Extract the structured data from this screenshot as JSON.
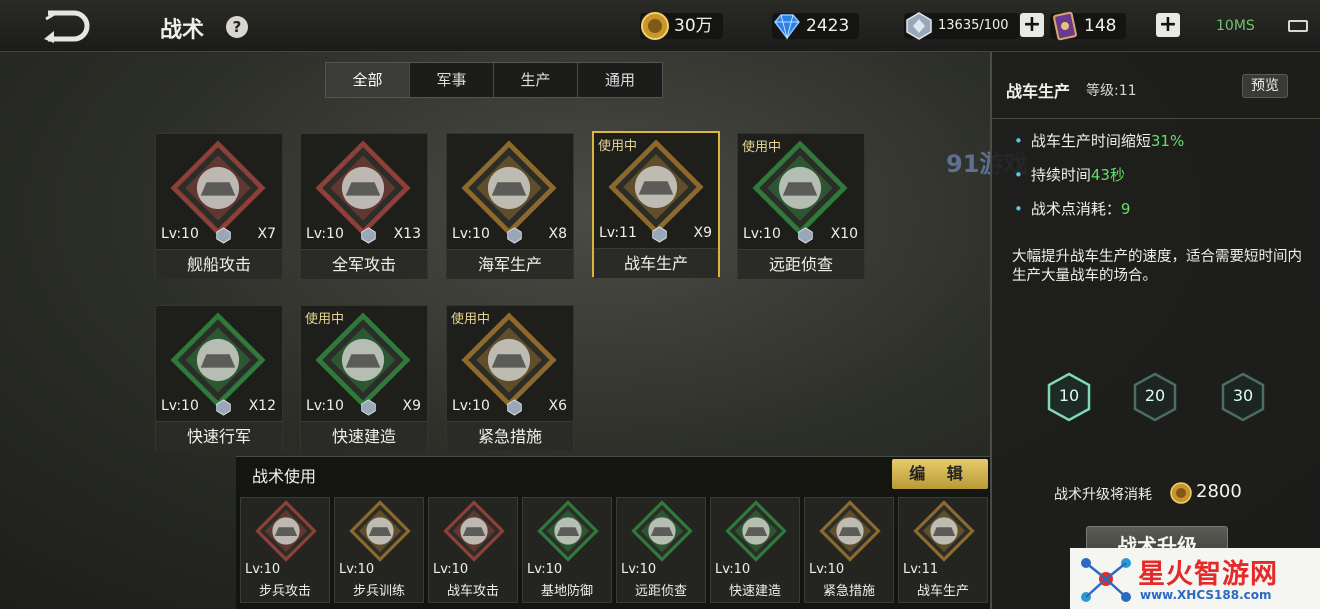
{
  "header": {
    "title": "战术",
    "help_label": "?",
    "gold": "30万",
    "diamond": "2423",
    "crystal": "13635/100",
    "card": "148",
    "ping": "10MS"
  },
  "tabs": [
    "全部",
    "军事",
    "生产",
    "通用"
  ],
  "skills": [
    {
      "name": "舰船攻击",
      "lv": "Lv:10",
      "count": "X7",
      "inuse": "",
      "theme": "#8e4038"
    },
    {
      "name": "全军攻击",
      "lv": "Lv:10",
      "count": "X13",
      "inuse": "",
      "theme": "#8e4038"
    },
    {
      "name": "海军生产",
      "lv": "Lv:10",
      "count": "X8",
      "inuse": "",
      "theme": "#8d6a2c"
    },
    {
      "name": "战车生产",
      "lv": "Lv:11",
      "count": "X9",
      "inuse": "使用中",
      "theme": "#8d6a2c"
    },
    {
      "name": "远距侦查",
      "lv": "Lv:10",
      "count": "X10",
      "inuse": "使用中",
      "theme": "#2f7a3b"
    },
    {
      "name": "快速行军",
      "lv": "Lv:10",
      "count": "X12",
      "inuse": "",
      "theme": "#2f7a3b"
    },
    {
      "name": "快速建造",
      "lv": "Lv:10",
      "count": "X9",
      "inuse": "使用中",
      "theme": "#2f7a3b"
    },
    {
      "name": "紧急措施",
      "lv": "Lv:10",
      "count": "X6",
      "inuse": "使用中",
      "theme": "#8d6a2c"
    }
  ],
  "detail": {
    "title": "战车生产",
    "level": "等级:11",
    "preview_label": "预览",
    "stat1_prefix": "战车生产时间缩短",
    "stat1_value": "31%",
    "stat2_prefix": "持续时间",
    "stat2_value": "43秒",
    "stat3_prefix": "战术点消耗：",
    "stat3_value": "9",
    "description": "大幅提升战车生产的速度，适合需要短时间内生产大量战车的场合。",
    "levels": [
      "10",
      "20",
      "30"
    ],
    "cost_label": "战术升级将消耗",
    "cost_value": "2800",
    "upgrade_label": "战术升级"
  },
  "usage": {
    "title": "战术使用",
    "edit_label": "编 辑",
    "items": [
      {
        "name": "步兵攻击",
        "lv": "Lv:10",
        "theme": "#8e4038"
      },
      {
        "name": "步兵训练",
        "lv": "Lv:10",
        "theme": "#8d6a2c"
      },
      {
        "name": "战车攻击",
        "lv": "Lv:10",
        "theme": "#8e4038"
      },
      {
        "name": "基地防御",
        "lv": "Lv:10",
        "theme": "#2f7a3b"
      },
      {
        "name": "远距侦查",
        "lv": "Lv:10",
        "theme": "#2f7a3b"
      },
      {
        "name": "快速建造",
        "lv": "Lv:10",
        "theme": "#2f7a3b"
      },
      {
        "name": "紧急措施",
        "lv": "Lv:10",
        "theme": "#8d6a2c"
      },
      {
        "name": "战车生产",
        "lv": "Lv:11",
        "theme": "#8d6a2c"
      }
    ]
  },
  "watermark": {
    "site_name": "星火智游网",
    "site_url": "www.XHCS188.com",
    "overlay": "91游戏"
  }
}
